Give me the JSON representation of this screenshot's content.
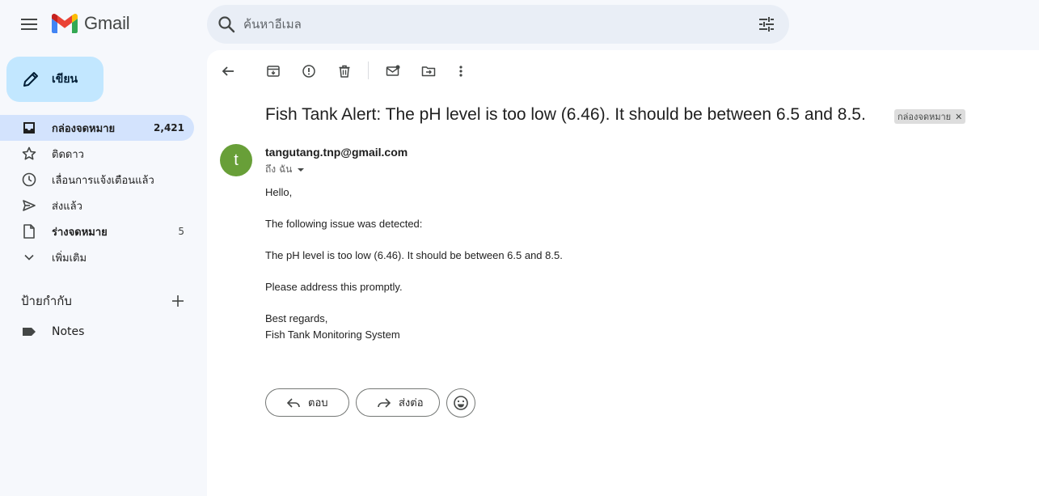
{
  "app": {
    "name": "Gmail"
  },
  "search": {
    "placeholder": "ค้นหาอีเมล"
  },
  "compose": {
    "label": "เขียน"
  },
  "sidebar": {
    "items": [
      {
        "label": "กล่องจดหมาย",
        "count": "2,421",
        "icon": "inbox-icon"
      },
      {
        "label": "ติดดาว",
        "count": "",
        "icon": "star-icon"
      },
      {
        "label": "เลื่อนการแจ้งเตือนแล้ว",
        "count": "",
        "icon": "clock-icon"
      },
      {
        "label": "ส่งแล้ว",
        "count": "",
        "icon": "send-icon"
      },
      {
        "label": "ร่างจดหมาย",
        "count": "5",
        "icon": "draft-icon"
      },
      {
        "label": "เพิ่มเติม",
        "count": "",
        "icon": "chevron-down-icon"
      }
    ],
    "labels_title": "ป้ายกำกับ",
    "labels": [
      {
        "label": "Notes",
        "icon": "label-icon"
      }
    ]
  },
  "email": {
    "subject": "Fish Tank Alert: The pH level is too low (6.46). It should be between 6.5 and 8.5.",
    "tag": "กล่องจดหมาย",
    "sender": "tangutang.tnp@gmail.com",
    "avatar_letter": "t",
    "to": "ถึง ฉัน",
    "body": [
      "Hello,",
      "The following issue was detected:",
      "The pH level is too low (6.46). It should be between 6.5 and 8.5.",
      "Please address this promptly.",
      "Best regards,",
      "Fish Tank Monitoring System"
    ]
  },
  "actions": {
    "reply": "ตอบ",
    "forward": "ส่งต่อ"
  },
  "colors": {
    "compose_bg": "#c2e7ff",
    "active_nav": "#d3e3fd",
    "avatar": "#689f38",
    "background": "#f6f8fc"
  }
}
